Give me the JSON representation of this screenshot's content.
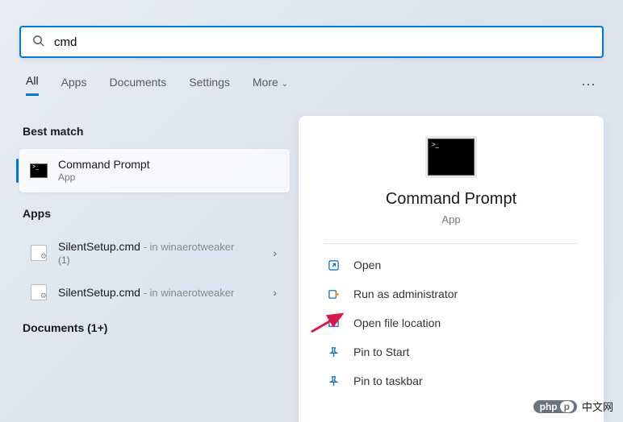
{
  "search": {
    "query": "cmd"
  },
  "tabs": {
    "items": [
      "All",
      "Apps",
      "Documents",
      "Settings",
      "More"
    ],
    "active": 0
  },
  "results": {
    "best_match_label": "Best match",
    "best_match": {
      "title": "Command Prompt",
      "subtitle": "App"
    },
    "apps_label": "Apps",
    "apps": [
      {
        "title": "SilentSetup.cmd",
        "context": " - in winaerotweaker",
        "extra": "(1)"
      },
      {
        "title": "SilentSetup.cmd",
        "context": " - in winaerotweaker",
        "extra": ""
      }
    ],
    "documents_label": "Documents (1+)"
  },
  "preview": {
    "title": "Command Prompt",
    "subtitle": "App",
    "actions": [
      {
        "icon": "open",
        "label": "Open"
      },
      {
        "icon": "admin",
        "label": "Run as administrator"
      },
      {
        "icon": "folder",
        "label": "Open file location"
      },
      {
        "icon": "pin",
        "label": "Pin to Start"
      },
      {
        "icon": "pin",
        "label": "Pin to taskbar"
      }
    ]
  },
  "watermark": {
    "badge1": "php",
    "badge2": "p",
    "text": "中文网"
  }
}
